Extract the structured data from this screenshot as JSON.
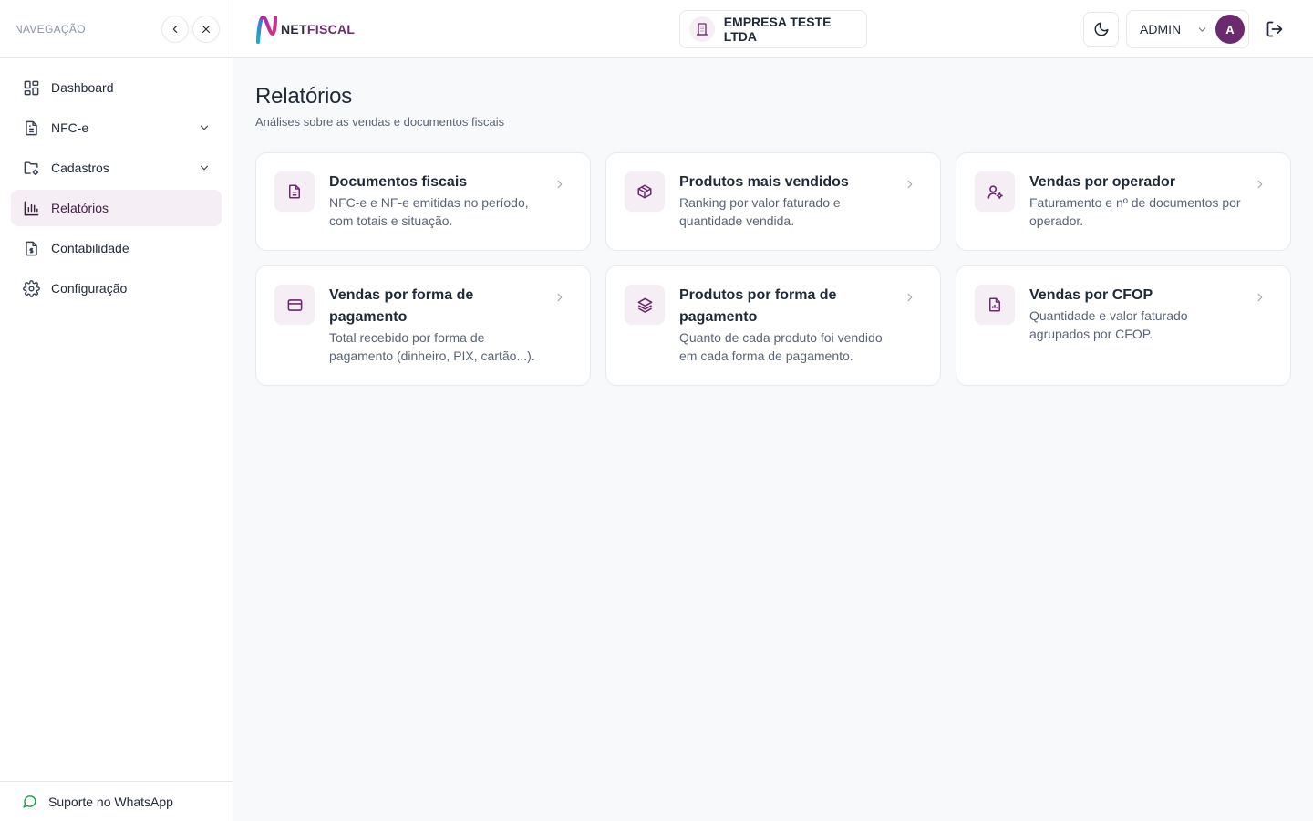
{
  "sidebar": {
    "title": "NAVEGAÇÃO",
    "items": [
      {
        "label": "Dashboard",
        "icon": "grid-icon",
        "has_chevron": false
      },
      {
        "label": "NFC-e",
        "icon": "document-icon",
        "has_chevron": true
      },
      {
        "label": "Cadastros",
        "icon": "folder-settings-icon",
        "has_chevron": true
      },
      {
        "label": "Relatórios",
        "icon": "bar-chart-icon",
        "has_chevron": false,
        "active": true
      },
      {
        "label": "Contabilidade",
        "icon": "file-dollar-icon",
        "has_chevron": false
      },
      {
        "label": "Configuração",
        "icon": "gear-icon",
        "has_chevron": false
      }
    ],
    "footer": {
      "label": "Suporte no WhatsApp",
      "icon": "chat-icon"
    }
  },
  "topbar": {
    "logo_part1": "NET",
    "logo_part2": "FISCAL",
    "company": "EMPRESA TESTE LTDA",
    "user": "ADMIN",
    "avatar_initial": "A"
  },
  "page": {
    "title": "Relatórios",
    "subtitle": "Análises sobre as vendas e documentos fiscais"
  },
  "cards": [
    {
      "title": "Documentos fiscais",
      "description": "NFC-e e NF-e emitidas no período, com totais e situação.",
      "icon": "document-icon"
    },
    {
      "title": "Produtos mais vendidos",
      "description": "Ranking por valor faturado e quantidade vendida.",
      "icon": "box-icon"
    },
    {
      "title": "Vendas por operador",
      "description": "Faturamento e nº de documentos por operador.",
      "icon": "user-settings-icon"
    },
    {
      "title": "Vendas por forma de pagamento",
      "description": "Total recebido por forma de pagamento (dinheiro, PIX, cartão...).",
      "icon": "credit-card-icon"
    },
    {
      "title": "Produtos por forma de pagamento",
      "description": "Quanto de cada produto foi vendido em cada forma de pagamento.",
      "icon": "layers-icon"
    },
    {
      "title": "Vendas por CFOP",
      "description": "Quantidade e valor faturado agrupados por CFOP.",
      "icon": "file-chart-icon"
    }
  ],
  "colors": {
    "brand": "#6b2a6f",
    "active_bg": "#f5eef5",
    "whatsapp": "#16a34a"
  }
}
